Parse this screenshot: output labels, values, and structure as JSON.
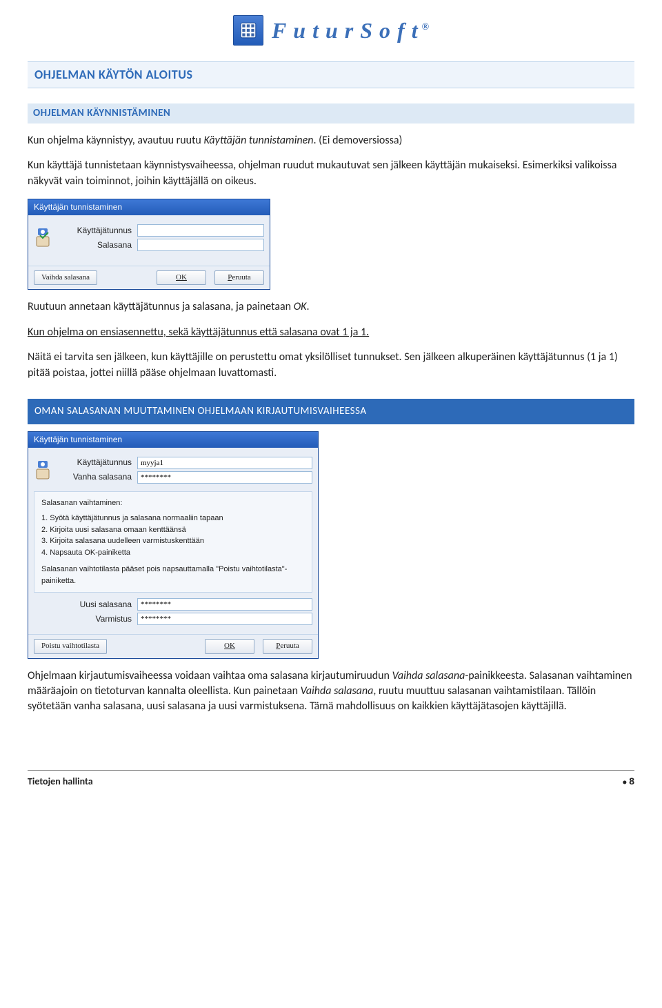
{
  "brand": {
    "title": "FuturSoft",
    "reg": "®"
  },
  "h1": "OHJELMAN KÄYTÖN ALOITUS",
  "h2": "OHJELMAN KÄYNNISTÄMINEN",
  "p1a": "Kun ohjelma käynnistyy, avautuu ruutu ",
  "p1b": "Käyttäjän tunnistaminen",
  "p1c": ". (Ei demoversiossa)",
  "p2": "Kun käyttäjä tunnistetaan käynnistysvaiheessa, ohjelman ruudut mukautuvat sen jälkeen käyttäjän mukaiseksi. Esimerkiksi valikoissa näkyvät vain toiminnot, joihin käyttäjällä on oikeus.",
  "dlg1": {
    "title": "Käyttäjän tunnistaminen",
    "user_label": "Käyttäjätunnus",
    "pass_label": "Salasana",
    "btn_change": "Vaihda salasana",
    "btn_ok": "OK",
    "btn_cancel": "Peruuta"
  },
  "p3a": "Ruutuun annetaan käyttäjätunnus ja salasana, ja painetaan ",
  "p3b": "OK",
  "p3c": ".",
  "p4": "Kun ohjelma on ensiasennettu, sekä käyttäjätunnus että salasana ovat 1 ja 1.",
  "p5": "Näitä ei tarvita sen jälkeen, kun käyttäjille on perustettu omat yksilölliset tunnukset. Sen jälkeen alkuperäinen käyttäjätunnus (1 ja 1) pitää poistaa, jottei niillä pääse ohjelmaan luvattomasti.",
  "h3": "OMAN SALASANAN MUUTTAMINEN OHJELMAAN KIRJAUTUMISVAIHEESSA",
  "dlg2": {
    "title": "Käyttäjän tunnistaminen",
    "user_label": "Käyttäjätunnus",
    "user_value": "myyja1",
    "oldpass_label": "Vanha salasana",
    "oldpass_value": "********",
    "panel_title": "Salasanan vaihtaminen:",
    "steps": [
      "1. Syötä käyttäjätunnus ja salasana normaaliin tapaan",
      "2. Kirjoita uusi salasana omaan kenttäänsä",
      "3. Kirjoita salasana uudelleen varmistuskenttään",
      "4. Napsauta OK-painiketta"
    ],
    "panel_foot": "Salasanan vaihtotilasta pääset pois napsauttamalla \"Poistu vaihtotilasta\"-painiketta.",
    "newpass_label": "Uusi salasana",
    "newpass_value": "********",
    "confirm_label": "Varmistus",
    "confirm_value": "********",
    "btn_exit": "Poistu vaihtotilasta",
    "btn_ok": "OK",
    "btn_cancel": "Peruuta"
  },
  "p6a": "Ohjelmaan kirjautumisvaiheessa voidaan vaihtaa oma salasana kirjautumiruudun ",
  "p6b": "Vaihda salasana",
  "p6c": "-painikkeesta. Salasanan vaihtaminen määräajoin on tietoturvan kannalta oleellista. Kun painetaan ",
  "p6d": "Vaihda salasana",
  "p6e": ", ruutu muuttuu salasanan vaihtamistilaan. Tällöin syötetään vanha salasana, uusi salasana ja uusi varmistuksena. Tämä mahdollisuus on kaikkien käyttäjätasojen käyttäjillä.",
  "footer": {
    "left": "Tietojen hallinta",
    "page": "8"
  }
}
